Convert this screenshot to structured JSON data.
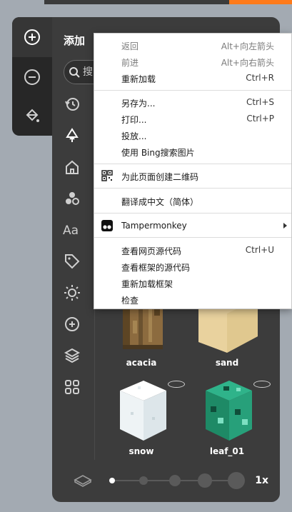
{
  "panel": {
    "title": "添加",
    "search_placeholder": "搜"
  },
  "tiles": [
    {
      "name": "acacia"
    },
    {
      "name": "sand"
    },
    {
      "name": "snow"
    },
    {
      "name": "leaf_01"
    }
  ],
  "zoom": {
    "label": "1x",
    "selected_step": 1,
    "steps": 5
  },
  "context_menu": {
    "items": [
      {
        "label": "返回",
        "shortcut": "Alt+向左箭头",
        "disabled": true
      },
      {
        "label": "前进",
        "shortcut": "Alt+向右箭头",
        "disabled": true
      },
      {
        "label": "重新加载",
        "shortcut": "Ctrl+R"
      },
      {
        "label": "另存为...",
        "shortcut": "Ctrl+S"
      },
      {
        "label": "打印...",
        "shortcut": "Ctrl+P"
      },
      {
        "label": "投放..."
      },
      {
        "label": "使用 Bing搜索图片"
      },
      {
        "label": "为此页面创建二维码",
        "icon": "qr-code-icon"
      },
      {
        "label": "翻译成中文（简体）"
      },
      {
        "label": "Tampermonkey",
        "icon": "tampermonkey-icon",
        "submenu": true
      },
      {
        "label": "查看网页源代码",
        "shortcut": "Ctrl+U"
      },
      {
        "label": "查看框架的源代码"
      },
      {
        "label": "重新加载框架"
      },
      {
        "label": "检查"
      }
    ]
  },
  "colors": {
    "panel_bg": "#3c3c3c",
    "rail_bg": "#272727",
    "page_bg": "#a3aab2",
    "accent_strip": "#ff7a1a",
    "menu_bg": "#ffffff"
  }
}
